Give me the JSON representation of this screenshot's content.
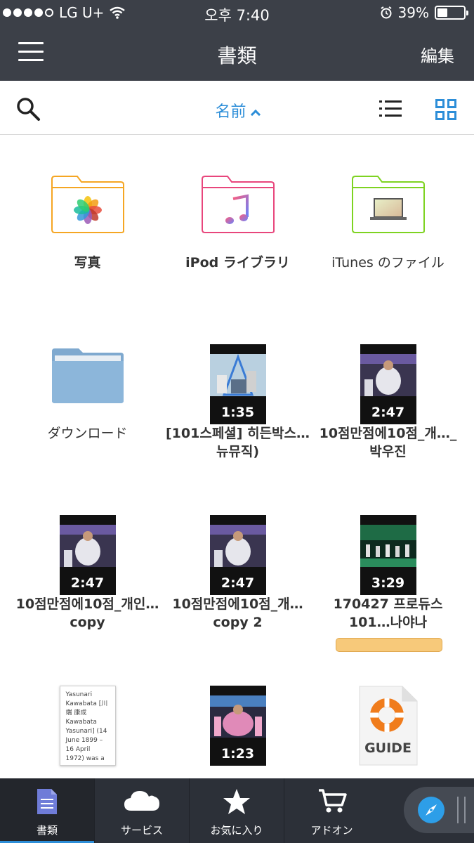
{
  "status_bar": {
    "carrier": "LG U+",
    "time": "오후 7:40",
    "battery_percent": "39%",
    "battery_level": 0.39
  },
  "nav": {
    "title": "書類",
    "edit_label": "編集"
  },
  "toolbar": {
    "sort_label": "名前"
  },
  "items": [
    {
      "label": "写真",
      "kind": "folder-photos",
      "color": "#f5a623"
    },
    {
      "label": "iPod ライブラリ",
      "kind": "folder-music",
      "color": "#e8467c"
    },
    {
      "label": "iTunes のファイル",
      "kind": "folder-itunes",
      "color": "#7ed321"
    },
    {
      "label": "ダウンロード",
      "kind": "folder-download",
      "color": "#8ab4d8"
    },
    {
      "label": "[101스페셜] 히든박스…뉴뮤직)",
      "kind": "video",
      "duration": "1:35"
    },
    {
      "label": "10점만점에10점_개…_박우진",
      "kind": "video",
      "duration": "2:47"
    },
    {
      "label": "10점만점에10점_개인…copy",
      "kind": "video",
      "duration": "2:47"
    },
    {
      "label": "10점만점에10점_개…copy 2",
      "kind": "video",
      "duration": "2:47"
    },
    {
      "label": "170427 프로듀스 101…나야나",
      "kind": "video",
      "duration": "3:29"
    },
    {
      "label": "Yasunari Kawabata [川端 康成 Kawabata Yasunari] (14 June 1899 – 16 April 1972) was a",
      "kind": "document"
    },
    {
      "label": "",
      "kind": "video",
      "duration": "1:23"
    },
    {
      "label": "GUIDE",
      "kind": "guide"
    }
  ],
  "tabs": [
    {
      "label": "書類",
      "icon": "document-icon"
    },
    {
      "label": "サービス",
      "icon": "cloud-icon"
    },
    {
      "label": "お気に入り",
      "icon": "star-icon"
    },
    {
      "label": "アドオン",
      "icon": "cart-icon"
    }
  ],
  "colors": {
    "header": "#3c4048",
    "accent": "#2d8ed8",
    "tabbar": "#2c3038"
  }
}
